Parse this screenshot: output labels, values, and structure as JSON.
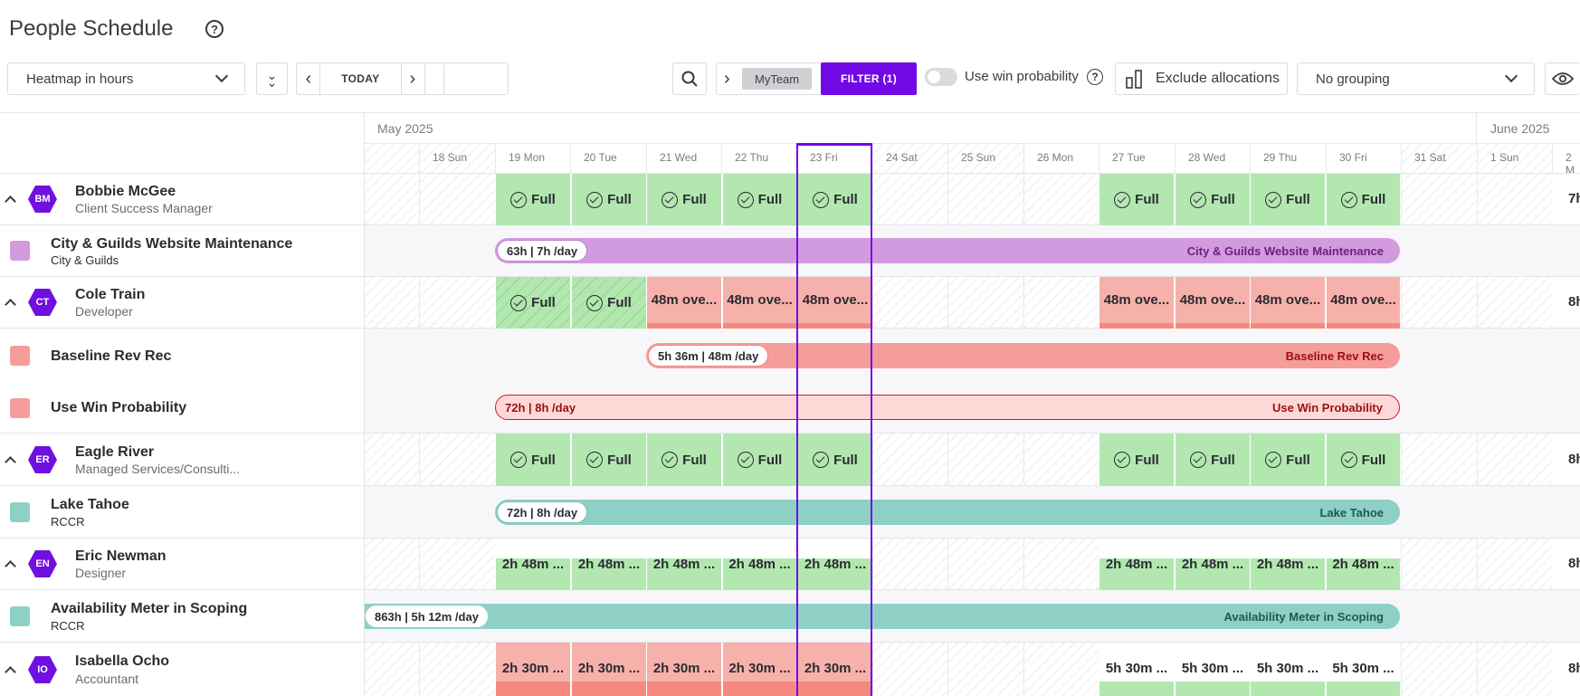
{
  "header": {
    "title": "People Schedule",
    "view_select": "Heatmap in hours",
    "today_label": "TODAY",
    "myteam_label": "MyTeam",
    "filter_label": "FILTER (1)",
    "win_prob_label": "Use win probability",
    "exclude_label": "Exclude allocations",
    "grouping_select": "No grouping"
  },
  "months": [
    "May 2025",
    "June 2025"
  ],
  "days": [
    "18 Sun",
    "19 Mon",
    "20 Tue",
    "21 Wed",
    "22 Thu",
    "23 Fri",
    "24 Sat",
    "25 Sun",
    "26 Mon",
    "27 Tue",
    "28 Wed",
    "29 Thu",
    "30 Fri",
    "31 Sat",
    "1 Sun",
    "2 M"
  ],
  "rows": {
    "bobbie": {
      "initials": "BM",
      "name": "Bobbie McGee",
      "role": "Client Success Manager",
      "cell": "Full",
      "right": "7h"
    },
    "citygilds": {
      "name": "City & Guilds Website Maintenance",
      "client": "City & Guilds",
      "pill": "63h | 7h /day",
      "bar": "City & Guilds Website Maintenance",
      "color": "#d29bdf"
    },
    "cole": {
      "initials": "CT",
      "name": "Cole Train",
      "role": "Developer",
      "full": "Full",
      "over": "48m ove...",
      "right": "8h"
    },
    "baseline": {
      "name": "Baseline Rev Rec",
      "pill": "5h 36m | 48m /day",
      "bar": "Baseline Rev Rec",
      "color": "#f59d9a"
    },
    "winprob": {
      "name": "Use Win Probability",
      "pill": "72h | 8h /day",
      "bar": "Use Win Probability"
    },
    "eagle": {
      "initials": "ER",
      "name": "Eagle River",
      "role": "Managed Services/Consulti...",
      "cell": "Full",
      "right": "8h"
    },
    "tahoe": {
      "name": "Lake Tahoe",
      "client": "RCCR",
      "pill": "72h | 8h /day",
      "bar": "Lake Tahoe",
      "color": "#8ed0c6"
    },
    "eric": {
      "initials": "EN",
      "name": "Eric Newman",
      "role": "Designer",
      "cell": "2h 48m ...",
      "right": "8h"
    },
    "meter": {
      "name": "Availability Meter in Scoping",
      "client": "RCCR",
      "pill": "863h | 5h 12m /day",
      "bar": "Availability Meter in Scoping",
      "color": "#8ed0c6"
    },
    "isabella": {
      "initials": "IO",
      "name": "Isabella Ocho",
      "role": "Accountant",
      "cell_a": "2h 30m ...",
      "cell_b": "5h 30m ...",
      "right": "8h"
    }
  }
}
